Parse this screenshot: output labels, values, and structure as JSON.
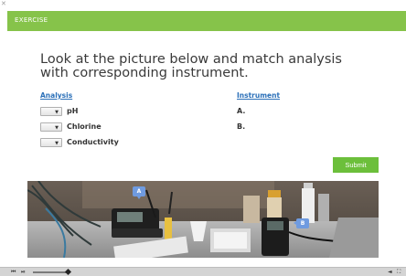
{
  "header": {
    "title": "EXERCISE",
    "accent_color": "#86c34a"
  },
  "question": {
    "text": "Look at the picture below and match analysis with corresponding instrument."
  },
  "columns": {
    "analysis": "Analysis",
    "instrument": "Instrument"
  },
  "analysis_items": [
    {
      "label": "pH",
      "selected": ""
    },
    {
      "label": "Chlorine",
      "selected": ""
    },
    {
      "label": "Conductivity",
      "selected": ""
    }
  ],
  "instruments": [
    {
      "label": "A."
    },
    {
      "label": "B."
    }
  ],
  "submit": {
    "label": "Submit",
    "color": "#6cbf3b"
  },
  "photo": {
    "callouts": [
      "A",
      "B"
    ],
    "callout_color": "#6f9be0"
  },
  "player": {
    "icons": [
      "prev-icon",
      "play-icon",
      "volume-icon",
      "fullscreen-icon"
    ]
  }
}
